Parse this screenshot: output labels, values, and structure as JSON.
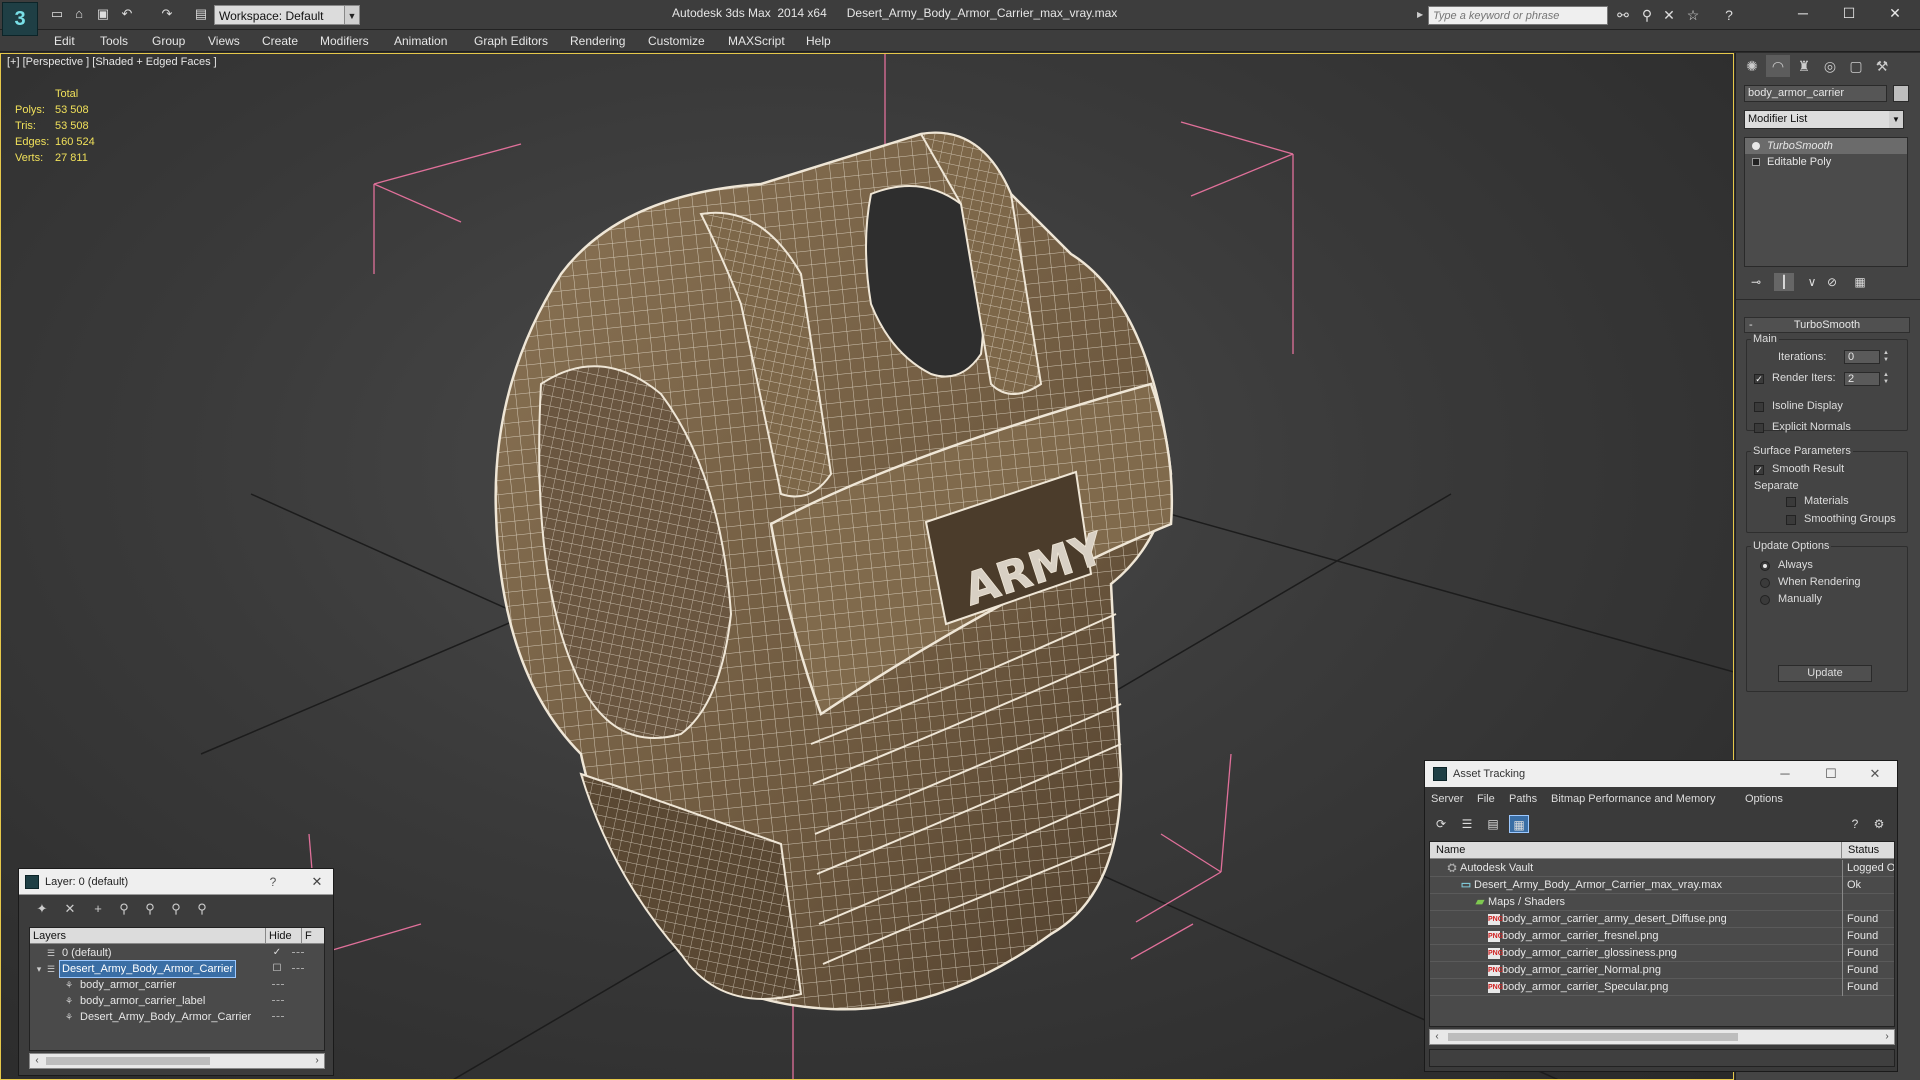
{
  "app": {
    "title": "Autodesk 3ds Max  2014 x64      Desert_Army_Body_Armor_Carrier_max_vray.max",
    "workspace": "Workspace: Default",
    "search_placeholder": "Type a keyword or phrase",
    "logo_glyph": "3"
  },
  "quick_access": [
    "new-file-icon",
    "open-file-icon",
    "save-icon",
    "undo-icon",
    "redo-icon",
    "project-folder-icon"
  ],
  "menu": [
    "Edit",
    "Tools",
    "Group",
    "Views",
    "Create",
    "Modifiers",
    "Animation",
    "Graph Editors",
    "Rendering",
    "Customize",
    "MAXScript",
    "Help"
  ],
  "viewport": {
    "label": "[+] [Perspective ] [Shaded + Edged Faces ]",
    "stats": {
      "header": "Total",
      "rows": [
        {
          "key": "Polys:",
          "value": "53 508"
        },
        {
          "key": "Tris:",
          "value": "53 508"
        },
        {
          "key": "Edges:",
          "value": "160 524"
        },
        {
          "key": "Verts:",
          "value": "27 811"
        }
      ]
    },
    "vest_label": "ARMY",
    "colors": {
      "vest_fill": "#7a6448",
      "vest_dark": "#4f3e2c",
      "wire": "#efe6d6",
      "bbox": "#e0709a",
      "stats": "#f0e05a"
    }
  },
  "command_panel": {
    "object_name": "body_armor_carrier",
    "modifier_list": "Modifier List",
    "stack": [
      "TurboSmooth",
      "Editable Poly"
    ],
    "turbosmooth": {
      "title": "TurboSmooth",
      "main_label": "Main",
      "iterations_label": "Iterations:",
      "iterations": "0",
      "render_iters_label": "Render Iters:",
      "render_iters": "2",
      "isoline_display": "Isoline Display",
      "explicit_normals": "Explicit Normals",
      "surface_params": "Surface Parameters",
      "smooth_result": "Smooth Result",
      "separate": "Separate",
      "materials": "Materials",
      "smoothing_groups": "Smoothing Groups",
      "update_options": "Update Options",
      "always": "Always",
      "when_rendering": "When Rendering",
      "manually": "Manually",
      "update_button": "Update"
    }
  },
  "layer_explorer": {
    "title": "Layer: 0 (default)",
    "help": "?",
    "columns": {
      "layers": "Layers",
      "hide": "Hide",
      "freeze": "F"
    },
    "rows": [
      {
        "name": "0 (default)",
        "indent": 0,
        "hide": "✓",
        "selected": false
      },
      {
        "name": "Desert_Army_Body_Armor_Carrier",
        "indent": 0,
        "hide": "☐",
        "selected": true
      },
      {
        "name": "body_armor_carrier",
        "indent": 1,
        "hide": "",
        "selected": false
      },
      {
        "name": "body_armor_carrier_label",
        "indent": 1,
        "hide": "",
        "selected": false
      },
      {
        "name": "Desert_Army_Body_Armor_Carrier",
        "indent": 1,
        "hide": "",
        "selected": false
      }
    ]
  },
  "asset_tracking": {
    "title": "Asset Tracking",
    "menu": [
      "Server",
      "File",
      "Paths",
      "Bitmap Performance and Memory",
      "Options"
    ],
    "columns": {
      "name": "Name",
      "status": "Status"
    },
    "rows": [
      {
        "name": "Autodesk Vault",
        "status": "Logged O",
        "indent": 0,
        "kind": "vault"
      },
      {
        "name": "Desert_Army_Body_Armor_Carrier_max_vray.max",
        "status": "Ok",
        "indent": 1,
        "kind": "max"
      },
      {
        "name": "Maps / Shaders",
        "status": "",
        "indent": 2,
        "kind": "folder"
      },
      {
        "name": "body_armor_carrier_army_desert_Diffuse.png",
        "status": "Found",
        "indent": 3,
        "kind": "png"
      },
      {
        "name": "body_armor_carrier_fresnel.png",
        "status": "Found",
        "indent": 3,
        "kind": "png"
      },
      {
        "name": "body_armor_carrier_glossiness.png",
        "status": "Found",
        "indent": 3,
        "kind": "png"
      },
      {
        "name": "body_armor_carrier_Normal.png",
        "status": "Found",
        "indent": 3,
        "kind": "png"
      },
      {
        "name": "body_armor_carrier_Specular.png",
        "status": "Found",
        "indent": 3,
        "kind": "png"
      }
    ]
  }
}
